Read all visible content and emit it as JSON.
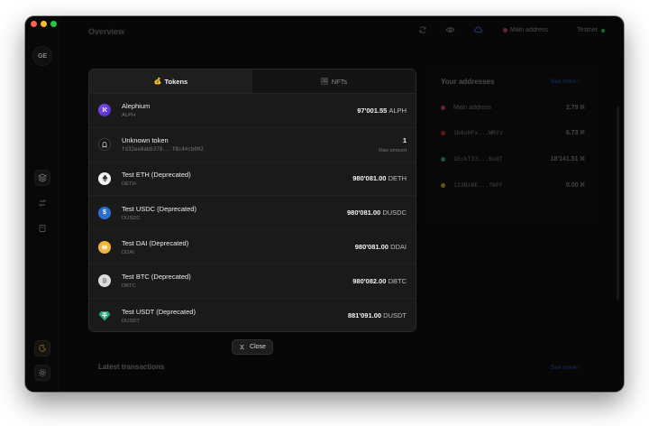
{
  "header": {
    "title": "Overview",
    "main_address_label": "Main address",
    "network": "Testnet"
  },
  "sidebar": {
    "avatar_initials": "GE"
  },
  "background": {
    "addresses_title": "Your addresses",
    "see_more": "See more",
    "addresses": [
      {
        "name": "Main address",
        "amount": "2.79 ℵ",
        "color": "#c23a6b"
      },
      {
        "name": "1b8oHFx...WRYz",
        "amount": "6.73 ℵ",
        "color": "#b0322d"
      },
      {
        "name": "1EckT33...6uQT",
        "amount": "18'141.51 ℵ",
        "color": "#2e9a8a"
      },
      {
        "name": "133BzBE...f6FF",
        "amount": "0.00 ℵ",
        "color": "#b59a2a"
      }
    ],
    "latest_title": "Latest transactions",
    "latest_see_more": "See more"
  },
  "modal": {
    "tabs": [
      {
        "label": "Tokens",
        "icon": "💰"
      },
      {
        "label": "NFTs",
        "icon": "🖼"
      }
    ],
    "tokens": [
      {
        "name": "Alephium",
        "symbol": "ALPH",
        "amount": "97'001.55",
        "unit": "ALPH",
        "icon": "alephium-icon",
        "color": "#6f3ae0",
        "glyph": "ℵ"
      },
      {
        "name": "Unknown token",
        "symbol": "fd32ee8abb378...f8c44cb002",
        "amount": "1",
        "unit": "",
        "note": "Raw amount",
        "icon": "unknown-token-icon",
        "color": "#1a1a1a",
        "glyph": "?"
      },
      {
        "name": "Test ETH (Deprecated)",
        "symbol": "DETH",
        "amount": "980'081.00",
        "unit": "DETH",
        "icon": "eth-icon",
        "color": "#e8e8e8",
        "glyph": "◆"
      },
      {
        "name": "Test USDC (Deprecated)",
        "symbol": "DUSDC",
        "amount": "980'081.00",
        "unit": "DUSDC",
        "icon": "usdc-icon",
        "color": "#2a6fcf",
        "glyph": "$"
      },
      {
        "name": "Test DAI (Deprecated)",
        "symbol": "DDAI",
        "amount": "980'081.00",
        "unit": "DDAI",
        "icon": "dai-icon",
        "color": "#f2b43a",
        "glyph": "◎"
      },
      {
        "name": "Test BTC (Deprecated)",
        "symbol": "DBTC",
        "amount": "980'082.00",
        "unit": "DBTC",
        "icon": "btc-icon",
        "color": "#d9d9d9",
        "glyph": "₿"
      },
      {
        "name": "Test USDT (Deprecated)",
        "symbol": "DUSDT",
        "amount": "881'091.00",
        "unit": "DUSDT",
        "icon": "usdt-icon",
        "color": "#26a17b",
        "glyph": "T"
      }
    ],
    "close_label": "Close"
  }
}
